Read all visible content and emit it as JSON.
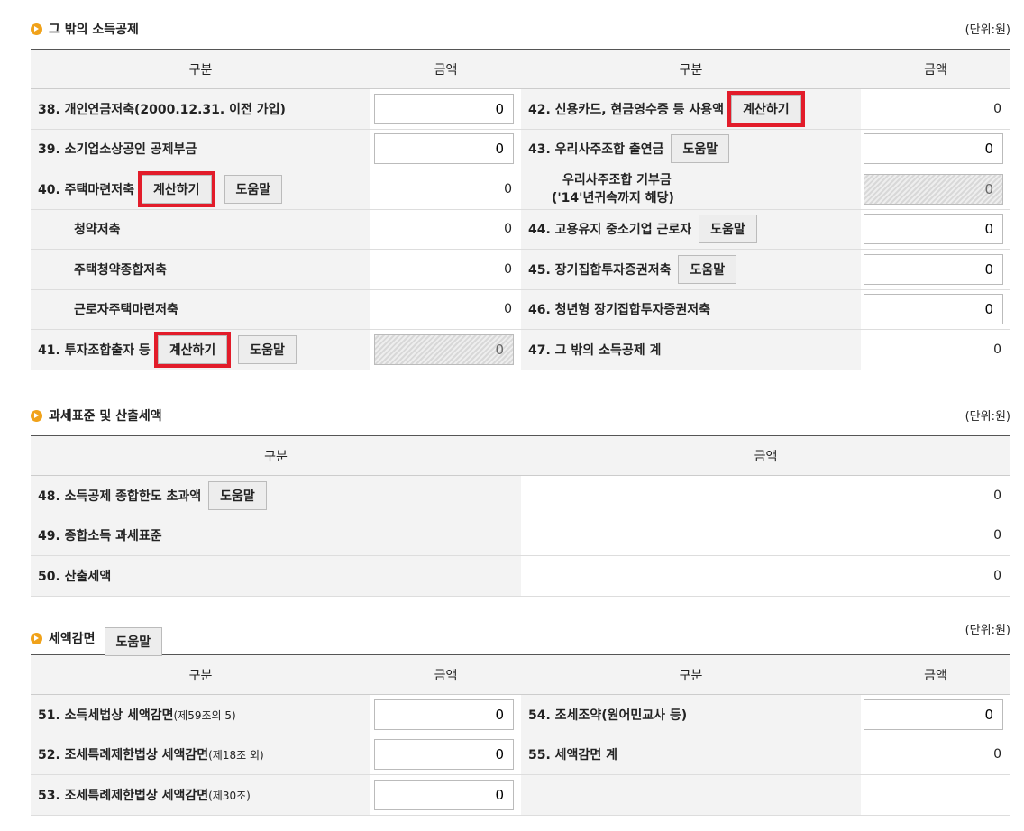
{
  "section1": {
    "title": "그 밖의 소득공제",
    "unit": "(단위:원)",
    "headers": [
      "구분",
      "금액",
      "구분",
      "금액"
    ],
    "calc_label": "계산하기",
    "help_label": "도움말",
    "left": [
      {
        "label": "38. 개인연금저축(2000.12.31. 이전 가입)",
        "value": "0"
      },
      {
        "label": "39. 소기업소상공인 공제부금",
        "value": "0"
      },
      {
        "label": "40. 주택마련저축",
        "value": "0"
      },
      {
        "label": "청약저축",
        "value": "0"
      },
      {
        "label": "주택청약종합저축",
        "value": "0"
      },
      {
        "label": "근로자주택마련저축",
        "value": "0"
      },
      {
        "label": "41. 투자조합출자 등",
        "value": "0"
      }
    ],
    "right": [
      {
        "label": "42. 신용카드, 현금영수증 등 사용액",
        "value": "0"
      },
      {
        "label": "43. 우리사주조합 출연금",
        "value": "0"
      },
      {
        "label_line1": "우리사주조합 기부금",
        "label_line2": "('14'년귀속까지 해당)",
        "value": "0"
      },
      {
        "label": "44. 고용유지 중소기업 근로자",
        "value": "0"
      },
      {
        "label": "45. 장기집합투자증권저축",
        "value": "0"
      },
      {
        "label": "46. 청년형 장기집합투자증권저축",
        "value": "0"
      },
      {
        "label": "47. 그 밖의 소득공제 계",
        "value": "0"
      }
    ]
  },
  "section2": {
    "title": "과세표준 및 산출세액",
    "unit": "(단위:원)",
    "headers": [
      "구분",
      "금액"
    ],
    "help_label": "도움말",
    "rows": [
      {
        "label": "48. 소득공제 종합한도 초과액",
        "value": "0"
      },
      {
        "label": "49. 종합소득 과세표준",
        "value": "0"
      },
      {
        "label": "50. 산출세액",
        "value": "0"
      }
    ]
  },
  "section3": {
    "title": "세액감면",
    "unit": "(단위:원)",
    "help_label": "도움말",
    "headers": [
      "구분",
      "금액",
      "구분",
      "금액"
    ],
    "left": [
      {
        "label": "51. 소득세법상 세액감면",
        "note": "(제59조의 5)",
        "value": "0"
      },
      {
        "label": "52. 조세특례제한법상 세액감면",
        "note": "(제18조 외)",
        "value": "0"
      },
      {
        "label": "53. 조세특례제한법상 세액감면",
        "note": "(제30조)",
        "value": "0"
      }
    ],
    "right": [
      {
        "label": "54. 조세조약(원어민교사 등)",
        "value": "0"
      },
      {
        "label": "55. 세액감면 계",
        "value": "0"
      }
    ]
  }
}
